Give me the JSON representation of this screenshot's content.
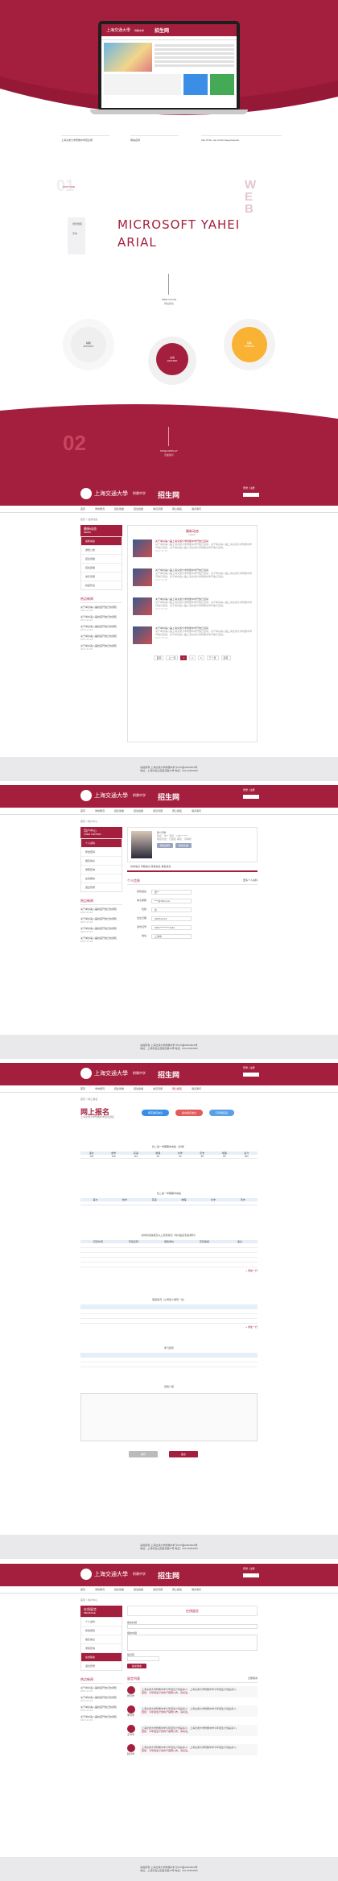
{
  "hero": {
    "school_logo": "上海交通大學",
    "school_sub": "附属中学",
    "enroll_title": "招生网",
    "caption_left_1": "上海交通大学附属中学招生网",
    "caption_mid": "网站名称",
    "caption_right_label": "http://",
    "caption_right_url": "http://fzbm.net.cn/thomasgohieputa"
  },
  "font_section": {
    "label_cn": "字体规范",
    "label_en": "FONT USE",
    "font_cn_1": "微软雅黑",
    "font_cn_2": "宋体",
    "font_main": "MICROSOFT YAHEI",
    "font_arial": "ARIAL",
    "web_vertical": "WEB"
  },
  "color_section": {
    "title_en": "WEB COLOR",
    "title_cn": "网站颜色",
    "circle_red_1": "主色",
    "circle_red_2": "#A0153D",
    "circle_gray_1": "辅助",
    "circle_gray_2": "#FFFFFF",
    "circle_yellow_1": "辅助",
    "circle_yellow_2": "#F9B233"
  },
  "page_display": {
    "num": "02",
    "title_en": "PAGE DISPLAY",
    "title_cn": "页面展示"
  },
  "site": {
    "logo_text": "上海交通大學",
    "logo_sub": "附属中学",
    "enroll": "招生网",
    "login": "登录 | 注册",
    "search_placeholder": "搜索",
    "nav": [
      "首页",
      "学校概况",
      "招生简章",
      "招生政策",
      "常见问题",
      "网上报名",
      "联系我们"
    ],
    "breadcrumb_1": "首页 > 最新动态",
    "breadcrumb_2": "首页 > 用户中心",
    "breadcrumb_3": "首页 > 网上报名",
    "breadcrumb_4": "首页 > 用户中心",
    "footer_1": "版权所有 上海交通大学附属中学 沪ICP备00000000号",
    "footer_2": "地址：上海市宝山区殷高路42号 电话：021-00000000"
  },
  "page1": {
    "side_title_cn": "最新动态",
    "side_title_en": "NEWS",
    "side_items": [
      "最新动态",
      "通知公告",
      "招生简章",
      "招生政策",
      "常见问题",
      "校园风采"
    ],
    "side_news_title": "热点新闻",
    "side_news": [
      "关于举办第八届校园开放日的通知",
      "关于举办第八届校园开放日的通知",
      "关于举办第八届校园开放日的通知",
      "关于举办第八届校园开放日的通知",
      "关于举办第八届校园开放日的通知"
    ],
    "side_news_date": "2017-11-15",
    "panel_title": "最新动态",
    "panel_sub": "NEWS",
    "articles": [
      {
        "title": "关于举办第八届上海交通大学附属中学开放日活动",
        "desc": "关于举办第八届上海交通大学附属中学开放日活动，关于举办第八届上海交通大学附属中学开放日活动，关于举办第八届上海交通大学附属中学开放日活动。",
        "date": "2017-11-15"
      },
      {
        "title": "关于举办第八届上海交通大学附属中学开放日活动",
        "desc": "关于举办第八届上海交通大学附属中学开放日活动，关于举办第八届上海交通大学附属中学开放日活动，关于举办第八届上海交通大学附属中学开放日活动。",
        "date": "2017-11-15"
      },
      {
        "title": "关于举办第八届上海交通大学附属中学开放日活动",
        "desc": "关于举办第八届上海交通大学附属中学开放日活动，关于举办第八届上海交通大学附属中学开放日活动，关于举办第八届上海交通大学附属中学开放日活动。",
        "date": "2017-11-15"
      },
      {
        "title": "关于举办第八届上海交通大学附属中学开放日活动",
        "desc": "关于举办第八届上海交通大学附属中学开放日活动，关于举办第八届上海交通大学附属中学开放日活动，关于举办第八届上海交通大学附属中学开放日活动。",
        "date": "2017-11-15"
      }
    ],
    "pager": [
      "首页",
      "上一页",
      "1",
      "2",
      "3",
      "下一页",
      "尾页"
    ]
  },
  "page2": {
    "side_title_cn": "用户中心",
    "side_title_en": "USER CENTER",
    "side_items": [
      "个人资料",
      "修改密码",
      "报名信息",
      "录取查询",
      "在线留言",
      "退出登录"
    ],
    "user_name": "张**同学",
    "user_line_1": "姓名：张**  手机：138********",
    "user_line_2": "报名状态：已报名  审核：待审核",
    "btn_1": "修改资料",
    "btn_2": "修改头像",
    "tabs": "基本信息  学籍信息  家庭信息  报名信息",
    "section_title": "个人信息",
    "section_link": "更多个人资料",
    "fields": [
      [
        "真实姓名",
        "张**"
      ],
      [
        "电子邮箱",
        "****@163.com"
      ],
      [
        "性别",
        "女"
      ],
      [
        "出生日期",
        "2005-03-12"
      ],
      [
        "身份证号",
        "3101**********1234"
      ],
      [
        "地址",
        "上海市"
      ]
    ]
  },
  "page3": {
    "title": "网上报名",
    "subtitle": "上海交通大学附属中学招生报名",
    "steps": [
      "填写报名信息",
      "提交报名信息",
      "打印报名表"
    ],
    "table1_title": "初二第一学期期末成绩（必填）",
    "table1_head": [
      "语文",
      "数学",
      "英语",
      "物理",
      "化学",
      "历史",
      "地理",
      "总分"
    ],
    "table1_row": [
      "105",
      "108",
      "110",
      "95",
      "90",
      "88",
      "85",
      "681"
    ],
    "table2_title": "初二第一学期期中成绩",
    "table2_head": [
      "语文",
      "数学",
      "英语",
      "物理",
      "化学",
      "历史"
    ],
    "table3_title": "初中阶段校级及以上获奖情况（时间由近到远排列）",
    "table3_head": [
      "获奖时间",
      "获奖名称",
      "颁奖单位",
      "获奖等级",
      "备注"
    ],
    "table4_title": "家庭情况（父母至少填写一位）",
    "table5_title": "学习经历",
    "table6_title": "自我介绍",
    "add_row": "+ 添加一行",
    "btn_save": "保存",
    "btn_submit": "提交"
  },
  "page4": {
    "side_title_cn": "在线留言",
    "side_title_en": "MESSAGE",
    "panel_title": "在线留言",
    "form_label_1": "留言标题",
    "form_label_2": "留言内容",
    "form_label_3": "验证码",
    "submit": "提交留言",
    "list_title": "留言列表",
    "list_more": "全部留言",
    "messages": [
      {
        "name": "张同学",
        "q": "上海交通大学附属中学今年招生计划是多少，上海交通大学附属中学今年招生计划是多少。",
        "a": "回复：今年招生计划将于官网公布，请关注。"
      },
      {
        "name": "李同学",
        "q": "上海交通大学附属中学今年招生计划是多少，上海交通大学附属中学今年招生计划是多少。",
        "a": "回复：今年招生计划将于官网公布，请关注。"
      },
      {
        "name": "王同学",
        "q": "上海交通大学附属中学今年招生计划是多少，上海交通大学附属中学今年招生计划是多少。",
        "a": "回复：今年招生计划将于官网公布，请关注。"
      },
      {
        "name": "赵同学",
        "q": "上海交通大学附属中学今年招生计划是多少，上海交通大学附属中学今年招生计划是多少。",
        "a": "回复：今年招生计划将于官网公布，请关注。"
      }
    ]
  },
  "colors": {
    "brand": "#a41e3d",
    "yellow": "#f9b233",
    "blue": "#3a8ee6"
  }
}
